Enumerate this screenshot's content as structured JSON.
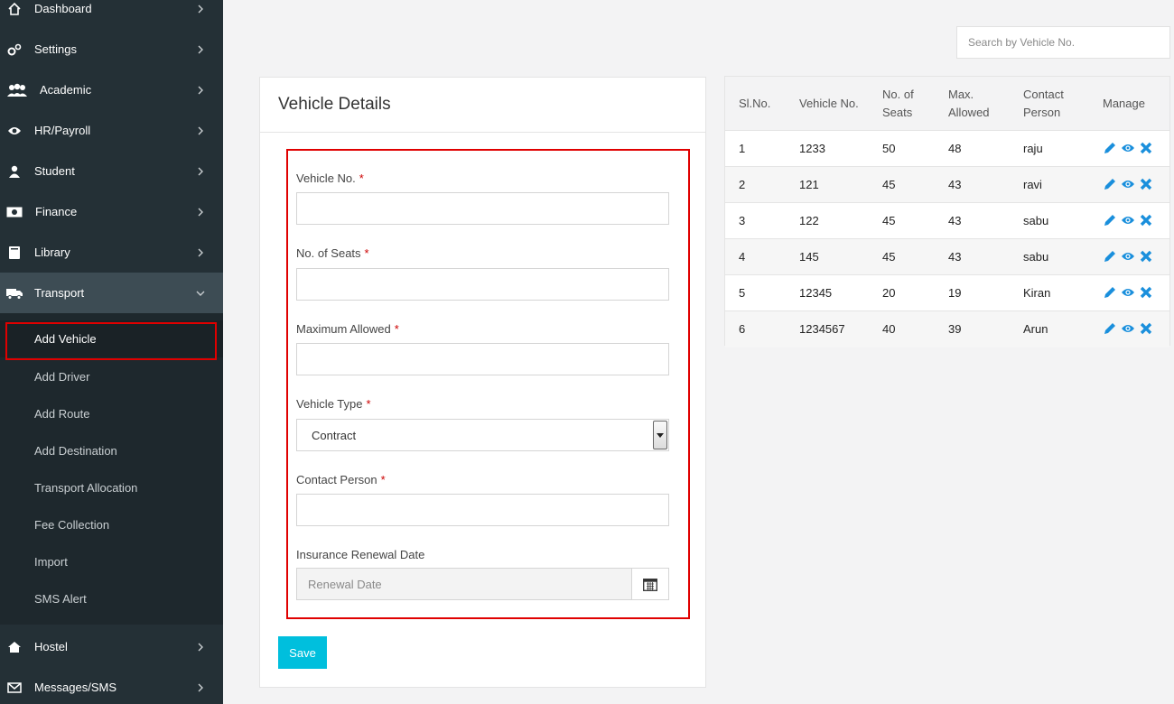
{
  "sidebar": {
    "items": [
      {
        "label": "Dashboard",
        "icon": "home-icon"
      },
      {
        "label": "Settings",
        "icon": "gears-icon"
      },
      {
        "label": "Academic",
        "icon": "users-icon"
      },
      {
        "label": "HR/Payroll",
        "icon": "eye-icon"
      },
      {
        "label": "Student",
        "icon": "user-icon"
      },
      {
        "label": "Finance",
        "icon": "money-icon"
      },
      {
        "label": "Library",
        "icon": "book-icon"
      },
      {
        "label": "Transport",
        "icon": "truck-icon"
      }
    ],
    "transport_submenu": [
      "Add Vehicle",
      "Add Driver",
      "Add Route",
      "Add Destination",
      "Transport Allocation",
      "Fee Collection",
      "Import",
      "SMS Alert"
    ],
    "bottom_items": [
      {
        "label": "Hostel",
        "icon": "home-icon"
      },
      {
        "label": "Messages/SMS",
        "icon": "envelope-icon"
      }
    ]
  },
  "search": {
    "placeholder": "Search by Vehicle No."
  },
  "form": {
    "title": "Vehicle Details",
    "required_mark": "*",
    "fields": {
      "vehicle_no": "Vehicle No.",
      "seats": "No. of Seats",
      "max_allowed": "Maximum Allowed",
      "vehicle_type": "Vehicle Type",
      "vehicle_type_value": "Contract",
      "contact_person": "Contact Person",
      "insurance": "Insurance Renewal Date",
      "insurance_placeholder": "Renewal Date"
    },
    "save_label": "Save"
  },
  "table": {
    "headers": {
      "slno": "Sl.No.",
      "vehicle_no": "Vehicle No.",
      "seats_1": "No. of",
      "seats_2": "Seats",
      "max_1": "Max.",
      "max_2": "Allowed",
      "contact_1": "Contact",
      "contact_2": "Person",
      "manage": "Manage"
    },
    "rows": [
      {
        "sl": "1",
        "vehicle": "1233",
        "seats": "50",
        "max": "48",
        "contact": "raju"
      },
      {
        "sl": "2",
        "vehicle": "121",
        "seats": "45",
        "max": "43",
        "contact": "ravi"
      },
      {
        "sl": "3",
        "vehicle": "122",
        "seats": "45",
        "max": "43",
        "contact": "sabu"
      },
      {
        "sl": "4",
        "vehicle": "145",
        "seats": "45",
        "max": "43",
        "contact": "sabu"
      },
      {
        "sl": "5",
        "vehicle": "12345",
        "seats": "20",
        "max": "19",
        "contact": "Kiran"
      },
      {
        "sl": "6",
        "vehicle": "1234567",
        "seats": "40",
        "max": "39",
        "contact": "Arun"
      }
    ]
  },
  "colors": {
    "sidebar_bg": "#243036",
    "submenu_bg": "#1e282d",
    "highlight": "#e00000",
    "save_button": "#00bfdd",
    "action_icons": "#1a8fdc"
  }
}
